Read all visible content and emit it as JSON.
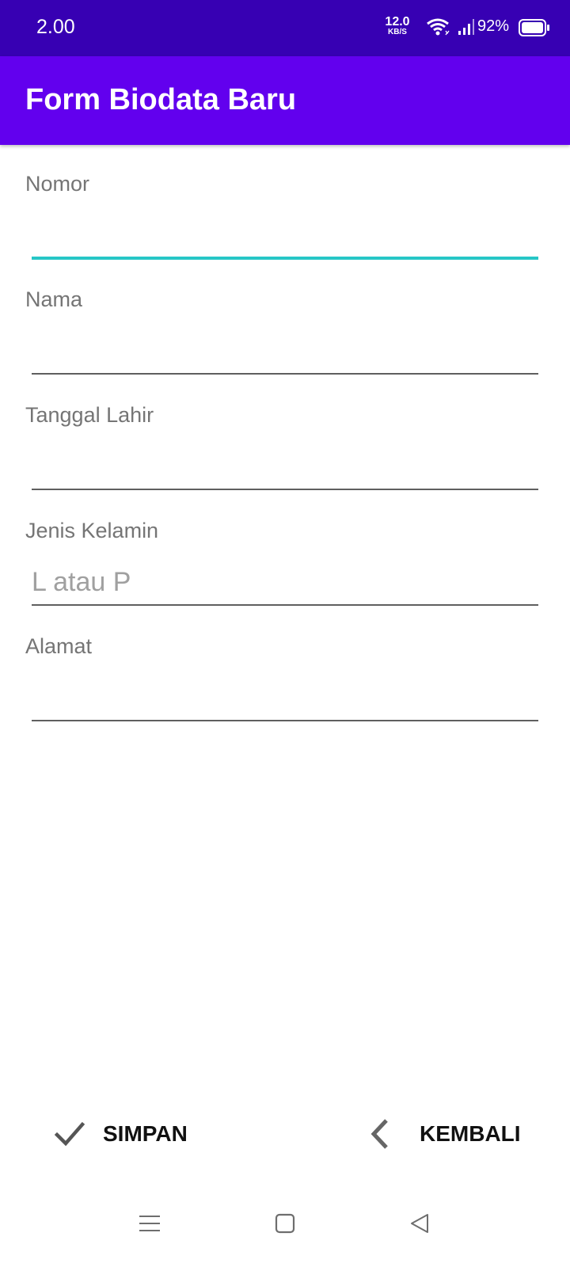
{
  "status_bar": {
    "time": "2.00",
    "net_speed_value": "12.0",
    "net_speed_unit": "KB/S",
    "battery_percent": "92%",
    "icons": [
      "wifi-icon",
      "signal-icon",
      "battery-icon"
    ]
  },
  "app_bar": {
    "title": "Form Biodata Baru",
    "background": "#6200ee"
  },
  "form": {
    "fields": [
      {
        "label": "Nomor",
        "value": "",
        "placeholder": "",
        "focused": true
      },
      {
        "label": "Nama",
        "value": "",
        "placeholder": ""
      },
      {
        "label": "Tanggal Lahir",
        "value": "",
        "placeholder": ""
      },
      {
        "label": "Jenis Kelamin",
        "value": "",
        "placeholder": "L atau P"
      },
      {
        "label": "Alamat",
        "value": "",
        "placeholder": ""
      }
    ],
    "focus_color": "#26c6c6"
  },
  "actions": {
    "save_label": "SIMPAN",
    "save_icon": "check-icon",
    "back_label": "KEMBALI",
    "back_icon": "chevron-left-icon"
  },
  "nav_bar": {
    "icons": [
      "menu-icon",
      "home-icon",
      "back-triangle-icon"
    ]
  },
  "colors": {
    "status_bar": "#3700b3",
    "app_bar": "#6200ee",
    "accent": "#26c6c6"
  }
}
